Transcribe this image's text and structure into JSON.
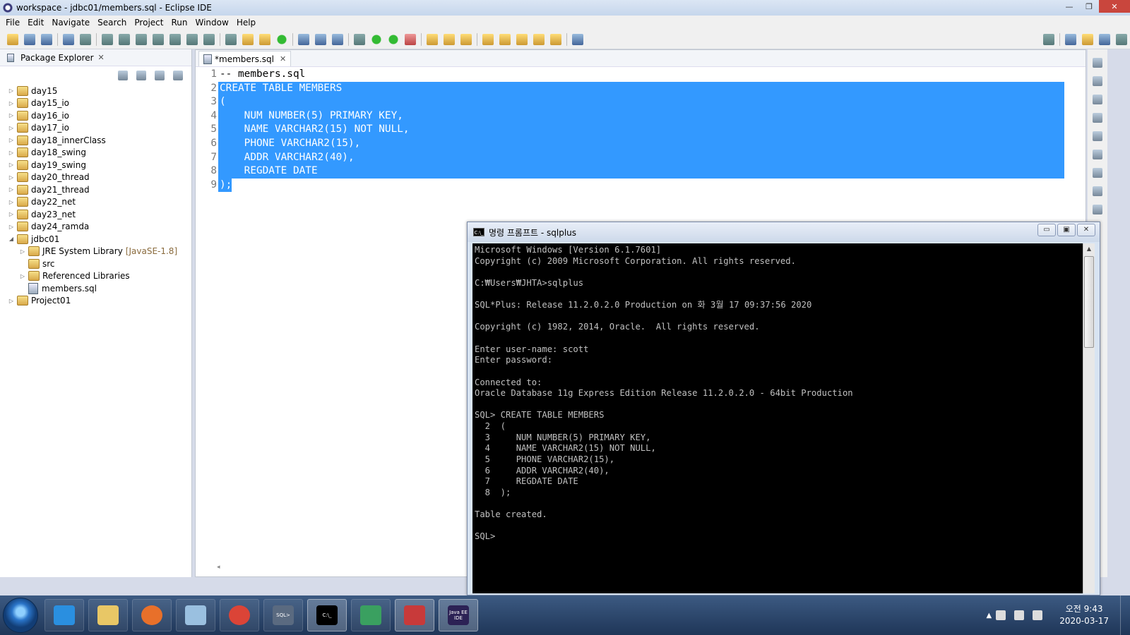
{
  "window": {
    "title": "workspace - jdbc01/members.sql - Eclipse IDE",
    "minimize": "—",
    "restore": "❐",
    "close": "✕"
  },
  "menu": [
    "File",
    "Edit",
    "Navigate",
    "Search",
    "Project",
    "Run",
    "Window",
    "Help"
  ],
  "package_explorer": {
    "title": "Package Explorer",
    "close": "✕",
    "items": [
      {
        "label": "day15",
        "level": 0,
        "twisty": "▷",
        "kind": "project"
      },
      {
        "label": "day15_io",
        "level": 0,
        "twisty": "▷",
        "kind": "project"
      },
      {
        "label": "day16_io",
        "level": 0,
        "twisty": "▷",
        "kind": "project"
      },
      {
        "label": "day17_io",
        "level": 0,
        "twisty": "▷",
        "kind": "project"
      },
      {
        "label": "day18_innerClass",
        "level": 0,
        "twisty": "▷",
        "kind": "project"
      },
      {
        "label": "day18_swing",
        "level": 0,
        "twisty": "▷",
        "kind": "project"
      },
      {
        "label": "day19_swing",
        "level": 0,
        "twisty": "▷",
        "kind": "project"
      },
      {
        "label": "day20_thread",
        "level": 0,
        "twisty": "▷",
        "kind": "project"
      },
      {
        "label": "day21_thread",
        "level": 0,
        "twisty": "▷",
        "kind": "project"
      },
      {
        "label": "day22_net",
        "level": 0,
        "twisty": "▷",
        "kind": "project"
      },
      {
        "label": "day23_net",
        "level": 0,
        "twisty": "▷",
        "kind": "project"
      },
      {
        "label": "day24_ramda",
        "level": 0,
        "twisty": "▷",
        "kind": "project"
      },
      {
        "label": "jdbc01",
        "level": 0,
        "twisty": "◢",
        "kind": "project"
      },
      {
        "label": "JRE System Library",
        "decor": "[JavaSE-1.8]",
        "level": 1,
        "twisty": "▷",
        "kind": "library"
      },
      {
        "label": "src",
        "level": 1,
        "twisty": "",
        "kind": "folder"
      },
      {
        "label": "Referenced Libraries",
        "level": 1,
        "twisty": "▷",
        "kind": "library"
      },
      {
        "label": "members.sql",
        "level": 1,
        "twisty": "",
        "kind": "file"
      },
      {
        "label": "Project01",
        "level": 0,
        "twisty": "▷",
        "kind": "project"
      }
    ]
  },
  "editor": {
    "tab": {
      "label": "*members.sql",
      "close": "✕"
    },
    "lines": [
      {
        "n": "1",
        "text": "-- members.sql",
        "sel": "none"
      },
      {
        "n": "2",
        "text": "CREATE TABLE MEMBERS",
        "sel": "full"
      },
      {
        "n": "3",
        "text": "(",
        "sel": "full"
      },
      {
        "n": "4",
        "text": "    NUM NUMBER(5) PRIMARY KEY,",
        "sel": "full"
      },
      {
        "n": "5",
        "text": "    NAME VARCHAR2(15) NOT NULL,",
        "sel": "full"
      },
      {
        "n": "6",
        "text": "    PHONE VARCHAR2(15),",
        "sel": "full"
      },
      {
        "n": "7",
        "text": "    ADDR VARCHAR2(40),",
        "sel": "full"
      },
      {
        "n": "8",
        "text": "    REGDATE DATE",
        "sel": "full"
      },
      {
        "n": "9",
        "text": ");",
        "sel": "partial"
      }
    ],
    "hscroll_arrow": "◂"
  },
  "cmd": {
    "title": "명령 프롬프트 - sqlplus",
    "icon_text": "C:\\_",
    "lines": [
      "Microsoft Windows [Version 6.1.7601]",
      "Copyright (c) 2009 Microsoft Corporation. All rights reserved.",
      "",
      "C:₩Users₩JHTA>sqlplus",
      "",
      "SQL*Plus: Release 11.2.0.2.0 Production on 화 3월 17 09:37:56 2020",
      "",
      "Copyright (c) 1982, 2014, Oracle.  All rights reserved.",
      "",
      "Enter user-name: scott",
      "Enter password:",
      "",
      "Connected to:",
      "Oracle Database 11g Express Edition Release 11.2.0.2.0 - 64bit Production",
      "",
      "SQL> CREATE TABLE MEMBERS",
      "  2  (",
      "  3     NUM NUMBER(5) PRIMARY KEY,",
      "  4     NAME VARCHAR2(15) NOT NULL,",
      "  5     PHONE VARCHAR2(15),",
      "  6     ADDR VARCHAR2(40),",
      "  7     REGDATE DATE",
      "  8  );",
      "",
      "Table created.",
      "",
      "SQL>"
    ],
    "minimize": "▭",
    "maximize": "▣",
    "close": "✕"
  },
  "taskbar": {
    "apps": [
      {
        "name": "internet-explorer",
        "color": "#2a8fe0"
      },
      {
        "name": "file-explorer",
        "color": "#e8c766"
      },
      {
        "name": "media-player",
        "color": "#e8702a"
      },
      {
        "name": "notepad",
        "color": "#9ac0e0"
      },
      {
        "name": "chrome",
        "color": "#db4437"
      },
      {
        "name": "sqlplus",
        "color": "#5a6a80",
        "text": "SQL>"
      },
      {
        "name": "cmd",
        "color": "#000000",
        "text": "C:\\_"
      },
      {
        "name": "media-center",
        "color": "#3aa060"
      },
      {
        "name": "snipping-tool",
        "color": "#c83a3a"
      },
      {
        "name": "eclipse",
        "color": "#2c2255",
        "text": "Java EE IDE"
      }
    ],
    "clock": {
      "time": "오전 9:43",
      "date": "2020-03-17"
    }
  },
  "colors": {
    "selection": "#3399ff",
    "taskbar": "#2a4670"
  }
}
